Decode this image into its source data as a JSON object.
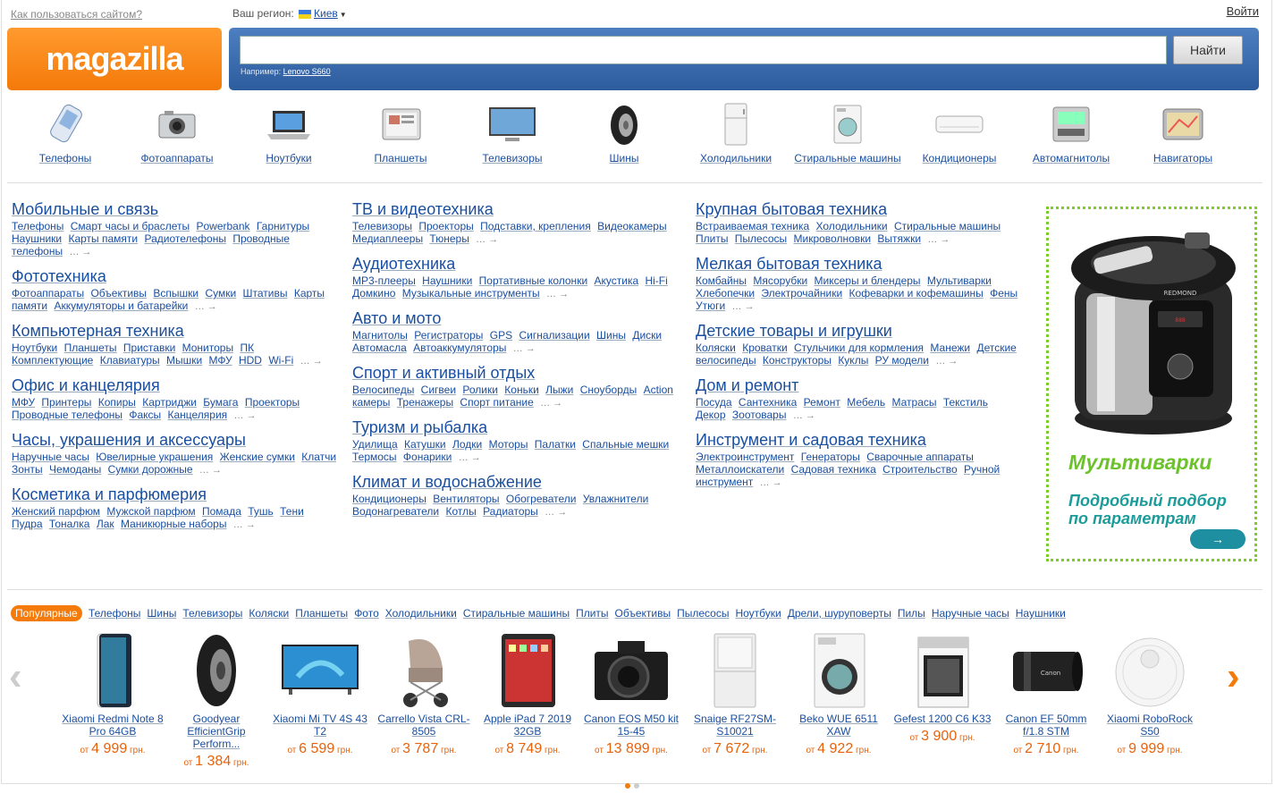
{
  "topbar": {
    "help": "Как пользоваться сайтом?",
    "region_label": "Ваш регион:",
    "region_city": "Киев",
    "login": "Войти"
  },
  "logo": {
    "text": "magazilla"
  },
  "search": {
    "value": "",
    "placeholder": "",
    "button": "Найти",
    "example_label": "Например:",
    "example_value": "Lenovo S660"
  },
  "categories": [
    {
      "label": "Телефоны",
      "icon": "phone-icon"
    },
    {
      "label": "Фотоаппараты",
      "icon": "camera-icon"
    },
    {
      "label": "Ноутбуки",
      "icon": "laptop-icon"
    },
    {
      "label": "Планшеты",
      "icon": "tablet-icon"
    },
    {
      "label": "Телевизоры",
      "icon": "tv-icon"
    },
    {
      "label": "Шины",
      "icon": "tire-icon"
    },
    {
      "label": "Холодильники",
      "icon": "fridge-icon"
    },
    {
      "label": "Стиральные машины",
      "icon": "washer-icon"
    },
    {
      "label": "Кондиционеры",
      "icon": "ac-icon"
    },
    {
      "label": "Автомагнитолы",
      "icon": "car-radio-icon"
    },
    {
      "label": "Навигаторы",
      "icon": "navigator-icon"
    }
  ],
  "columns": [
    [
      {
        "title": "Мобильные и связь",
        "links": [
          "Телефоны",
          "Смарт часы и браслеты",
          "Powerbank",
          "Гарнитуры",
          "Наушники",
          "Карты памяти",
          "Радиотелефоны",
          "Проводные телефоны"
        ]
      },
      {
        "title": "Фототехника",
        "links": [
          "Фотоаппараты",
          "Объективы",
          "Вспышки",
          "Сумки",
          "Штативы",
          "Карты памяти",
          "Аккумуляторы и батарейки"
        ]
      },
      {
        "title": "Компьютерная техника",
        "links": [
          "Ноутбуки",
          "Планшеты",
          "Приставки",
          "Мониторы",
          "ПК",
          "Комплектующие",
          "Клавиатуры",
          "Мышки",
          "МФУ",
          "HDD",
          "Wi-Fi"
        ]
      },
      {
        "title": "Офис и канцелярия",
        "links": [
          "МФУ",
          "Принтеры",
          "Копиры",
          "Картриджи",
          "Бумага",
          "Проекторы",
          "Проводные телефоны",
          "Факсы",
          "Канцелярия"
        ]
      },
      {
        "title": "Часы, украшения и аксессуары",
        "links": [
          "Наручные часы",
          "Ювелирные украшения",
          "Женские сумки",
          "Клатчи",
          "Зонты",
          "Чемоданы",
          "Сумки дорожные"
        ]
      },
      {
        "title": "Косметика и парфюмерия",
        "links": [
          "Женский парфюм",
          "Мужской парфюм",
          "Помада",
          "Тушь",
          "Тени",
          "Пудра",
          "Тоналка",
          "Лак",
          "Маникюрные наборы"
        ]
      }
    ],
    [
      {
        "title": "ТВ и видеотехника",
        "links": [
          "Телевизоры",
          "Проекторы",
          "Подставки, крепления",
          "Видеокамеры",
          "Медиаплееры",
          "Тюнеры"
        ]
      },
      {
        "title": "Аудиотехника",
        "links": [
          "MP3-плееры",
          "Наушники",
          "Портативные колонки",
          "Акустика",
          "Hi-Fi",
          "Домкино",
          "Музыкальные инструменты"
        ]
      },
      {
        "title": "Авто и мото",
        "links": [
          "Магнитолы",
          "Регистраторы",
          "GPS",
          "Сигнализации",
          "Шины",
          "Диски",
          "Автомасла",
          "Автоаккумуляторы"
        ]
      },
      {
        "title": "Спорт и активный отдых",
        "links": [
          "Велосипеды",
          "Сигвеи",
          "Ролики",
          "Коньки",
          "Лыжи",
          "Сноуборды",
          "Action камеры",
          "Тренажеры",
          "Спорт питание"
        ]
      },
      {
        "title": "Туризм и рыбалка",
        "links": [
          "Удилища",
          "Катушки",
          "Лодки",
          "Моторы",
          "Палатки",
          "Спальные мешки",
          "Термосы",
          "Фонарики"
        ]
      },
      {
        "title": "Климат и водоснабжение",
        "links": [
          "Кондиционеры",
          "Вентиляторы",
          "Обогреватели",
          "Увлажнители",
          "Водонагреватели",
          "Котлы",
          "Радиаторы"
        ]
      }
    ],
    [
      {
        "title": "Крупная бытовая техника",
        "links": [
          "Встраиваемая техника",
          "Холодильники",
          "Стиральные машины",
          "Плиты",
          "Пылесосы",
          "Микроволновки",
          "Вытяжки"
        ]
      },
      {
        "title": "Мелкая бытовая техника",
        "links": [
          "Комбайны",
          "Мясорубки",
          "Миксеры и блендеры",
          "Мультиварки",
          "Хлебопечки",
          "Электрочайники",
          "Кофеварки и кофемашины",
          "Фены",
          "Утюги"
        ]
      },
      {
        "title": "Детские товары и игрушки",
        "links": [
          "Коляски",
          "Кроватки",
          "Стульчики для кормления",
          "Манежи",
          "Детские велосипеды",
          "Конструкторы",
          "Куклы",
          "РУ модели"
        ]
      },
      {
        "title": "Дом и ремонт",
        "links": [
          "Посуда",
          "Сантехника",
          "Ремонт",
          "Мебель",
          "Матрасы",
          "Текстиль",
          "Декор",
          "Зоотовары"
        ]
      },
      {
        "title": "Инструмент и садовая техника",
        "links": [
          "Электроинструмент",
          "Генераторы",
          "Сварочные аппараты",
          "Металлоискатели",
          "Садовая техника",
          "Строительство",
          "Ручной инструмент"
        ]
      }
    ]
  ],
  "more_arrow": "… →",
  "ad": {
    "title": "Мультиварки",
    "subtitle": "Подробный подбор по параметрам",
    "button": "→",
    "brand": "REDMOND"
  },
  "popular": {
    "active": "Популярные",
    "tabs": [
      "Телефоны",
      "Шины",
      "Телевизоры",
      "Коляски",
      "Планшеты",
      "Фото",
      "Холодильники",
      "Стиральные машины",
      "Плиты",
      "Объективы",
      "Пылесосы",
      "Ноутбуки",
      "Дрели, шуруповерты",
      "Пилы",
      "Наручные часы",
      "Наушники"
    ]
  },
  "products": [
    {
      "name": "Xiaomi Redmi Note 8 Pro 64GB",
      "from": "от",
      "price": "4 999",
      "cur": "грн.",
      "icon": "phone-product-icon"
    },
    {
      "name": "Goodyear EfficientGrip Perform...",
      "from": "от",
      "price": "1 384",
      "cur": "грн.",
      "icon": "tire-product-icon"
    },
    {
      "name": "Xiaomi Mi TV 4S 43 T2",
      "from": "от",
      "price": "6 599",
      "cur": "грн.",
      "icon": "tv-product-icon"
    },
    {
      "name": "Carrello Vista CRL-8505",
      "from": "от",
      "price": "3 787",
      "cur": "грн.",
      "icon": "stroller-product-icon"
    },
    {
      "name": "Apple iPad 7 2019 32GB",
      "from": "от",
      "price": "8 749",
      "cur": "грн.",
      "icon": "tablet-product-icon"
    },
    {
      "name": "Canon EOS M50 kit 15-45",
      "from": "от",
      "price": "13 899",
      "cur": "грн.",
      "icon": "camera-product-icon"
    },
    {
      "name": "Snaige RF27SM-S10021",
      "from": "от",
      "price": "7 672",
      "cur": "грн.",
      "icon": "fridge-product-icon"
    },
    {
      "name": "Beko WUE 6511 XAW",
      "from": "от",
      "price": "4 922",
      "cur": "грн.",
      "icon": "washer-product-icon"
    },
    {
      "name": "Gefest 1200 C6 K33",
      "from": "от",
      "price": "3 900",
      "cur": "грн.",
      "icon": "stove-product-icon"
    },
    {
      "name": "Canon EF 50mm f/1.8 STM",
      "from": "от",
      "price": "2 710",
      "cur": "грн.",
      "icon": "lens-product-icon"
    },
    {
      "name": "Xiaomi RoboRock S50",
      "from": "от",
      "price": "9 999",
      "cur": "грн.",
      "icon": "robot-vacuum-product-icon"
    }
  ],
  "carousel": {
    "prev": "‹",
    "next": "›"
  },
  "colors": {
    "accent": "#f47a0a",
    "link": "#1a4fa0",
    "search_bg": "#2d5c9d",
    "ad_green": "#6cc22a",
    "ad_teal": "#1b9c9a",
    "price": "#e8620a"
  }
}
